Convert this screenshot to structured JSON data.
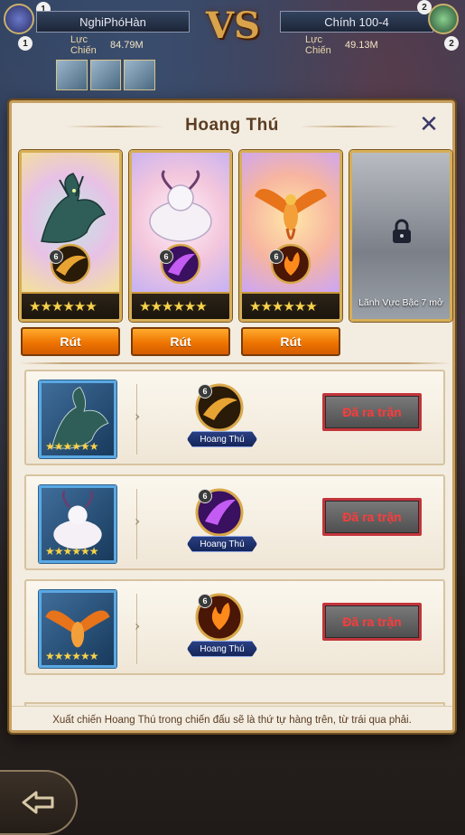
{
  "header": {
    "player_left": {
      "name": "NghiPhóHàn",
      "power_label": "Lực\nChiến",
      "power_value": "84.79M",
      "badge_num_top": "1",
      "badge_num_bottom": "1"
    },
    "player_right": {
      "name": "Chính 100-4",
      "power_label": "Lực\nChiến",
      "power_value": "49.13M",
      "badge_num_top": "2",
      "badge_num_bottom": "2"
    },
    "vs_label": "VS"
  },
  "panel": {
    "title": "Hoang Thú",
    "close_icon": "close-icon"
  },
  "cards": [
    {
      "beast": "dragon",
      "level": "6",
      "stars": "★★★★★★",
      "draw_label": "Rút",
      "accent": "#2e5a55"
    },
    {
      "beast": "white-beast",
      "level": "6",
      "stars": "★★★★★★",
      "draw_label": "Rút",
      "accent": "#8a3fd6"
    },
    {
      "beast": "phoenix",
      "level": "6",
      "stars": "★★★★★★",
      "draw_label": "Rút",
      "accent": "#e86a10"
    },
    {
      "beast": "locked",
      "locked_text": "Lãnh Vực Bậc 7 mở"
    }
  ],
  "rows": [
    {
      "portrait": "dragon",
      "stars": "★★★★★★",
      "skill_level": "6",
      "skill_name": "Hoang Thú",
      "status_label": "Đã ra trận"
    },
    {
      "portrait": "white-beast",
      "stars": "★★★★★★",
      "skill_level": "6",
      "skill_name": "Hoang Thú",
      "status_label": "Đã ra trận"
    },
    {
      "portrait": "phoenix",
      "stars": "★★★★★★",
      "skill_level": "6",
      "skill_name": "Hoang Thú",
      "status_label": "Đã ra trận"
    }
  ],
  "footer": {
    "note": "Xuất chiến Hoang Thú trong chiến đấu sẽ là thứ tự hàng trên, từ trái qua phải."
  },
  "colors": {
    "panel_bg": "#f3ece0",
    "draw_btn": "#ee7400",
    "deployed_text": "#ff3b3b",
    "deployed_border": "#c2343b",
    "gold_border": "#d7ae55"
  }
}
